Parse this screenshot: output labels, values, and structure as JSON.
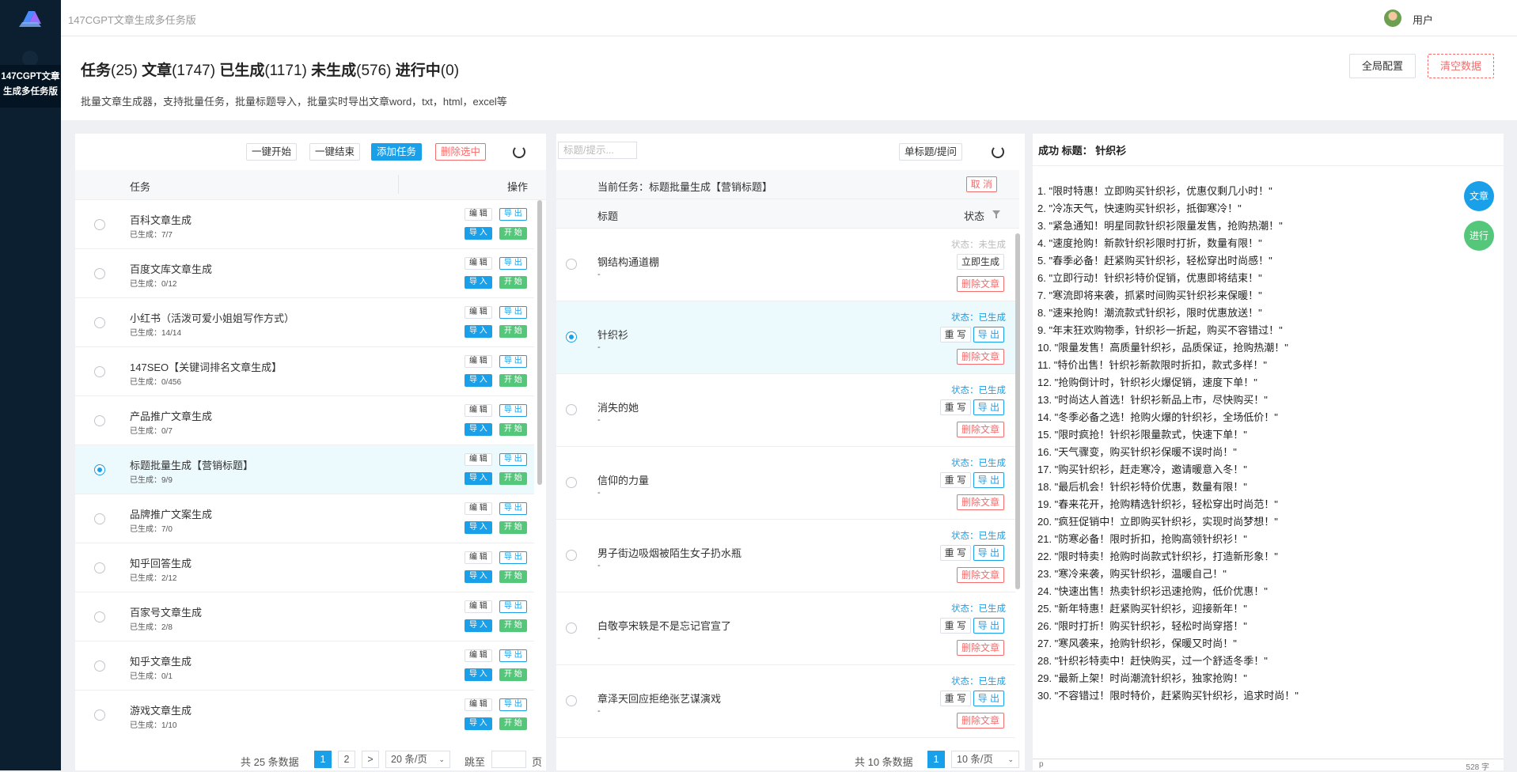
{
  "app": {
    "title": "147CGPT文章生成多任务版",
    "sidebar_active": "147CGPT文章生成多任务版",
    "user": "用户"
  },
  "header": {
    "stats": {
      "tasks_label": "任务",
      "tasks": "(25)",
      "articles_label": "文章",
      "articles": "(1747)",
      "generated_label": "已生成",
      "generated": "(1171)",
      "pending_label": "未生成",
      "pending": "(576)",
      "running_label": "进行中",
      "running": "(0)"
    },
    "description": "批量文章生成器，支持批量任务，批量标题导入，批量实时导出文章word，txt，html，excel等",
    "global_config": "全局配置",
    "clear_data": "清空数据"
  },
  "task_panel": {
    "toolbar": {
      "start_all": "一键开始",
      "stop_all": "一键结束",
      "add_task": "添加任务",
      "delete_selected": "删除选中"
    },
    "col_task": "任务",
    "col_action": "操作",
    "btn_edit": "编 辑",
    "btn_export": "导 出",
    "btn_import": "导 入",
    "btn_start": "开 始",
    "tasks": [
      {
        "name": "百科文章生成",
        "sub": "已生成：7/7"
      },
      {
        "name": "百度文库文章生成",
        "sub": "已生成：0/12"
      },
      {
        "name": "小红书（活泼可爱小姐姐写作方式）",
        "sub": "已生成：14/14"
      },
      {
        "name": "147SEO【关键词排名文章生成】",
        "sub": "已生成：0/456"
      },
      {
        "name": "产品推广文章生成",
        "sub": "已生成：0/7"
      },
      {
        "name": "标题批量生成【营销标题】",
        "sub": "已生成：9/9",
        "selected": true
      },
      {
        "name": "品牌推广文案生成",
        "sub": "已生成：7/0"
      },
      {
        "name": "知乎回答生成",
        "sub": "已生成：2/12"
      },
      {
        "name": "百家号文章生成",
        "sub": "已生成：2/8"
      },
      {
        "name": "知乎文章生成",
        "sub": "已生成：0/1"
      },
      {
        "name": "游戏文章生成",
        "sub": "已生成：1/10"
      }
    ],
    "pager": {
      "total": "共 25 条数据",
      "page1": "1",
      "page2": "2",
      "next": ">",
      "size": "20 条/页",
      "jump": "跳至",
      "page_unit": "页"
    }
  },
  "article_panel": {
    "search_placeholder": "标题/提示...",
    "single_btn": "单标题/提问",
    "current_task": "当前任务：标题批量生成【营销标题】",
    "cancel": "取 消",
    "col_title": "标题",
    "col_status": "状态",
    "btn_rewrite": "重 写",
    "btn_export": "导 出",
    "btn_now": "立即生成",
    "btn_delete": "删除文章",
    "articles": [
      {
        "title": "钢结构通道棚",
        "dash": "-",
        "status": "状态：未生成",
        "done": false
      },
      {
        "title": "针织衫",
        "dash": "-",
        "status": "状态：已生成",
        "done": true,
        "selected": true
      },
      {
        "title": "消失的她",
        "dash": "-",
        "status": "状态：已生成",
        "done": true
      },
      {
        "title": "信仰的力量",
        "dash": "-",
        "status": "状态：已生成",
        "done": true
      },
      {
        "title": "男子街边吸烟被陌生女子扔水瓶",
        "dash": "-",
        "status": "状态：已生成",
        "done": true
      },
      {
        "title": "白敬亭宋轶是不是忘记官宣了",
        "dash": "-",
        "status": "状态：已生成",
        "done": true
      },
      {
        "title": "章泽天回应拒绝张艺谋演戏",
        "dash": "-",
        "status": "状态：已生成",
        "done": true
      }
    ],
    "pager": {
      "total": "共 10 条数据",
      "page1": "1",
      "size": "10 条/页"
    }
  },
  "result_panel": {
    "title": "成功 标题： 针织衫",
    "btn_article": "文章",
    "btn_progress": "进行",
    "footer_left": "p",
    "footer_right": "528 字",
    "lines": [
      "1. \"限时特惠！立即购买针织衫，优惠仅剩几小时！\"",
      "2. \"冷冻天气，快速购买针织衫，抵御寒冷！\"",
      "3. \"紧急通知！明星同款针织衫限量发售，抢购热潮！\"",
      "4. \"速度抢购！新款针织衫限时打折，数量有限！\"",
      "5. \"春季必备！赶紧购买针织衫，轻松穿出时尚感！\"",
      "6. \"立即行动！针织衫特价促销，优惠即将结束！\"",
      "7. \"寒流即将来袭，抓紧时间购买针织衫来保暖！\"",
      "8. \"速来抢购！潮流款式针织衫，限时优惠放送！\"",
      "9. \"年末狂欢购物季，针织衫一折起，购买不容错过！\"",
      "10. \"限量发售！高质量针织衫，品质保证，抢购热潮！\"",
      "11. \"特价出售！针织衫新款限时折扣，款式多样！\"",
      "12. \"抢购倒计时，针织衫火爆促销，速度下单！\"",
      "13. \"时尚达人首选！针织衫新品上市，尽快购买！\"",
      "14. \"冬季必备之选！抢购火爆的针织衫，全场低价！\"",
      "15. \"限时疯抢！针织衫限量款式，快速下单！\"",
      "16. \"天气骤变，购买针织衫保暖不误时尚！\"",
      "17. \"购买针织衫，赶走寒冷，邀请暖意入冬！\"",
      "18. \"最后机会！针织衫特价优惠，数量有限！\"",
      "19. \"春来花开，抢购精选针织衫，轻松穿出时尚范！\"",
      "20. \"疯狂促销中！立即购买针织衫，实现时尚梦想！\"",
      "21. \"防寒必备！限时折扣，抢购高领针织衫！\"",
      "22. \"限时特卖！抢购时尚款式针织衫，打造新形象！\"",
      "23. \"寒冷来袭，购买针织衫，温暖自己！\"",
      "24. \"快速出售！热卖针织衫迅速抢购，低价优惠！\"",
      "25. \"新年特惠！赶紧购买针织衫，迎接新年！\"",
      "26. \"限时打折！购买针织衫，轻松时尚穿搭！\"",
      "27. \"寒风袭来，抢购针织衫，保暖又时尚！\"",
      "28. \"针织衫特卖中！赶快购买，过一个舒适冬季！\"",
      "29. \"最新上架！时尚潮流针织衫，独家抢购！\"",
      "30. \"不容错过！限时特价，赶紧购买针织衫，追求时尚！\""
    ]
  },
  "colors": {
    "primary": "#1aa0e9",
    "success": "#55c77b",
    "danger": "#f56c6c",
    "sidebar": "#0b1f30"
  }
}
